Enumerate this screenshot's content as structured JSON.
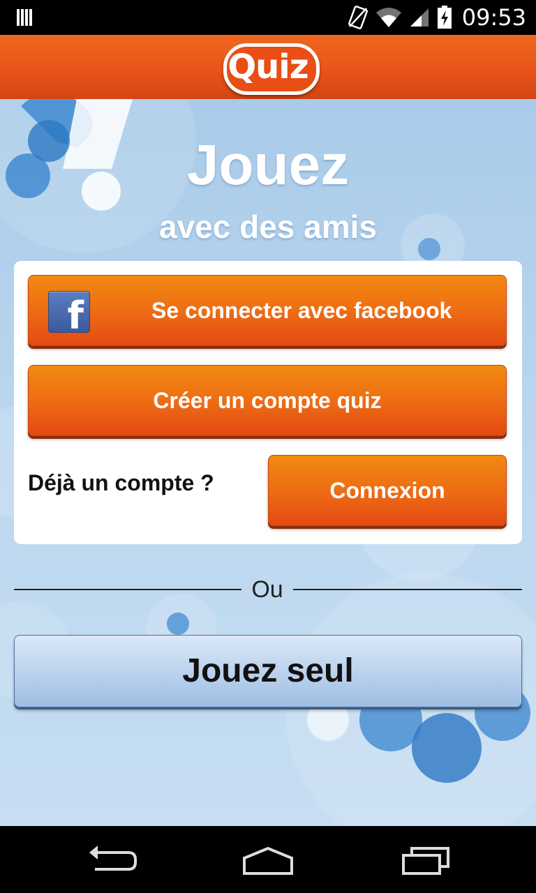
{
  "status_bar": {
    "time": "09:53",
    "icons": [
      "sim-icon",
      "no-sim-icon",
      "wifi-icon",
      "signal-icon",
      "battery-charging-icon"
    ]
  },
  "header": {
    "logo_text": "Quiz"
  },
  "hero": {
    "title": "Jouez",
    "subtitle": "avec des amis"
  },
  "card": {
    "facebook_button": "Se connecter avec facebook",
    "facebook_icon_letter": "f",
    "create_account_button": "Créer un compte quiz",
    "already_account_label": "Déjà un compte ?",
    "login_button": "Connexion"
  },
  "divider": {
    "text": "Ou"
  },
  "solo_button": "Jouez seul",
  "navigation": {
    "back": "back-icon",
    "home": "home-icon",
    "recents": "recent-apps-icon"
  },
  "colors": {
    "header": "#e85419",
    "orange_button": "#ee6d14",
    "background": "#bcd7ef",
    "solo_button": "#bcd3ee"
  }
}
